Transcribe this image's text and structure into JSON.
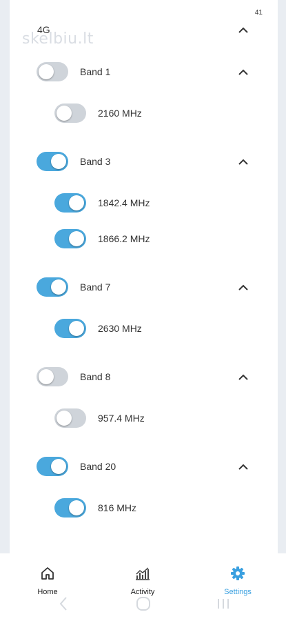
{
  "status_bar": {
    "signal_number": "41"
  },
  "watermark": "skelbiu.lt",
  "section": {
    "title": "4G"
  },
  "bands": [
    {
      "label": "Band 1",
      "enabled": false,
      "frequencies": [
        {
          "label": "2160 MHz",
          "enabled": false
        }
      ]
    },
    {
      "label": "Band 3",
      "enabled": true,
      "frequencies": [
        {
          "label": "1842.4 MHz",
          "enabled": true
        },
        {
          "label": "1866.2 MHz",
          "enabled": true
        }
      ]
    },
    {
      "label": "Band 7",
      "enabled": true,
      "frequencies": [
        {
          "label": "2630 MHz",
          "enabled": true
        }
      ]
    },
    {
      "label": "Band 8",
      "enabled": false,
      "frequencies": [
        {
          "label": "957.4 MHz",
          "enabled": false
        }
      ]
    },
    {
      "label": "Band 20",
      "enabled": true,
      "frequencies": [
        {
          "label": "816 MHz",
          "enabled": true
        }
      ]
    }
  ],
  "bottom_nav": {
    "items": [
      {
        "label": "Home",
        "icon": "home-icon",
        "active": false
      },
      {
        "label": "Activity",
        "icon": "activity-icon",
        "active": false
      },
      {
        "label": "Settings",
        "icon": "gear-icon",
        "active": true
      }
    ]
  },
  "colors": {
    "toggle_on": "#4aa8dd",
    "toggle_off": "#cfd4da",
    "accent": "#3aa0e0"
  }
}
